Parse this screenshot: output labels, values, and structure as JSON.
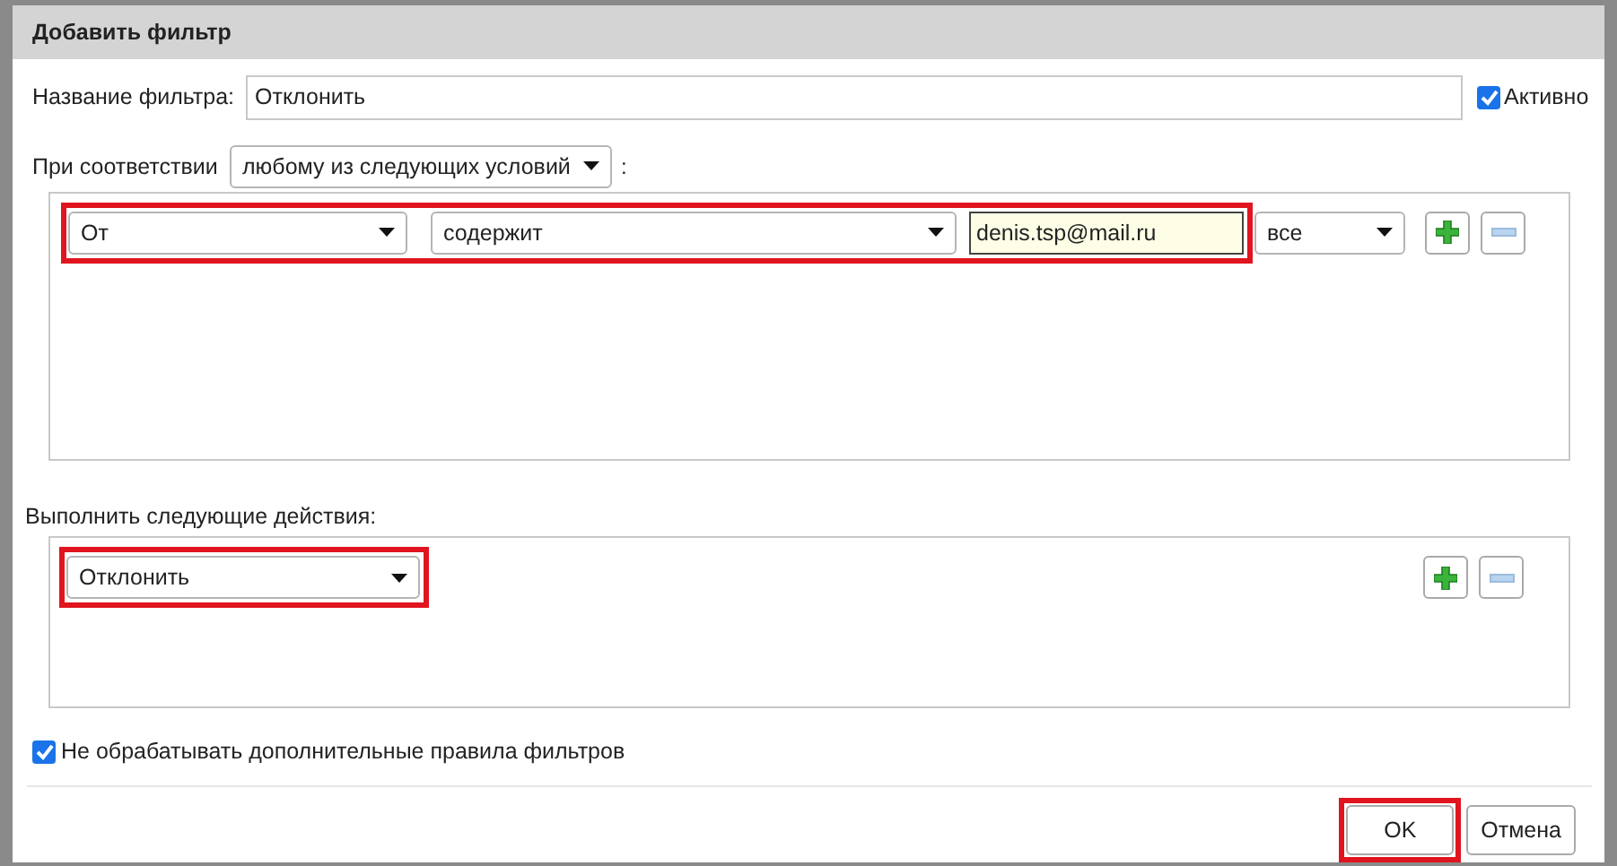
{
  "window": {
    "title": "Добавить фильтр"
  },
  "name_field": {
    "label": "Название фильтра:",
    "value": "Отклонить"
  },
  "active": {
    "label": "Активно",
    "checked": true
  },
  "match": {
    "label": "При соответствии",
    "value": "любому из следующих условий",
    "suffix": ":"
  },
  "conditions": [
    {
      "highlighted": true,
      "field": "От",
      "operator": "содержит",
      "value": "denis.tsp@mail.ru",
      "scope": "все"
    }
  ],
  "actions_label": "Выполнить следующие действия:",
  "actions": [
    {
      "highlighted": true,
      "value": "Отклонить"
    }
  ],
  "stop": {
    "label": "Не обрабатывать дополнительные правила фильтров",
    "checked": true
  },
  "buttons": [
    {
      "label": "OK",
      "highlighted": true
    },
    {
      "label": "Отмена",
      "highlighted": false
    }
  ]
}
